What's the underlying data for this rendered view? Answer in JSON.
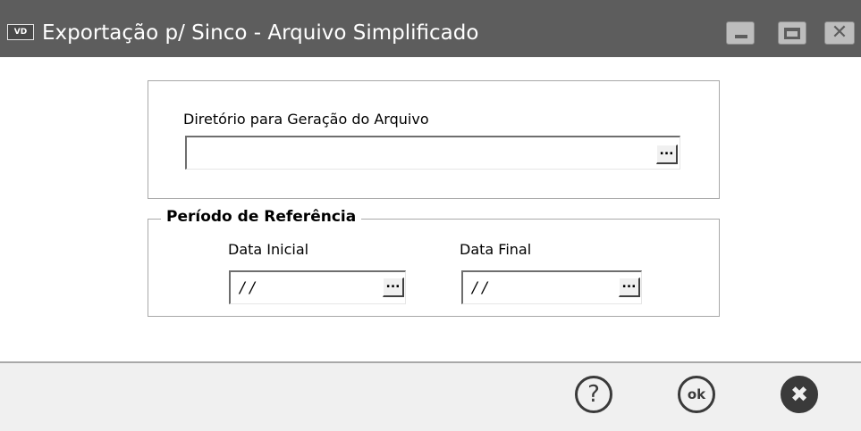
{
  "window": {
    "title": "Exportação p/ Sinco - Arquivo Simplificado",
    "icon_label": "VD",
    "minimize": "minimize-icon",
    "maximize": "maximize-icon",
    "close_glyph": "✕"
  },
  "directory": {
    "label": "Diretório para Geração do Arquivo",
    "value": "",
    "browse_label": "..."
  },
  "period": {
    "legend": "Período de Referência",
    "start_label": "Data Inicial",
    "start_value": "/ /",
    "end_label": "Data Final",
    "end_value": "/ /",
    "browse_label": "..."
  },
  "footer": {
    "help_label": "?",
    "ok_label": "ok",
    "cancel_label": "✖"
  }
}
